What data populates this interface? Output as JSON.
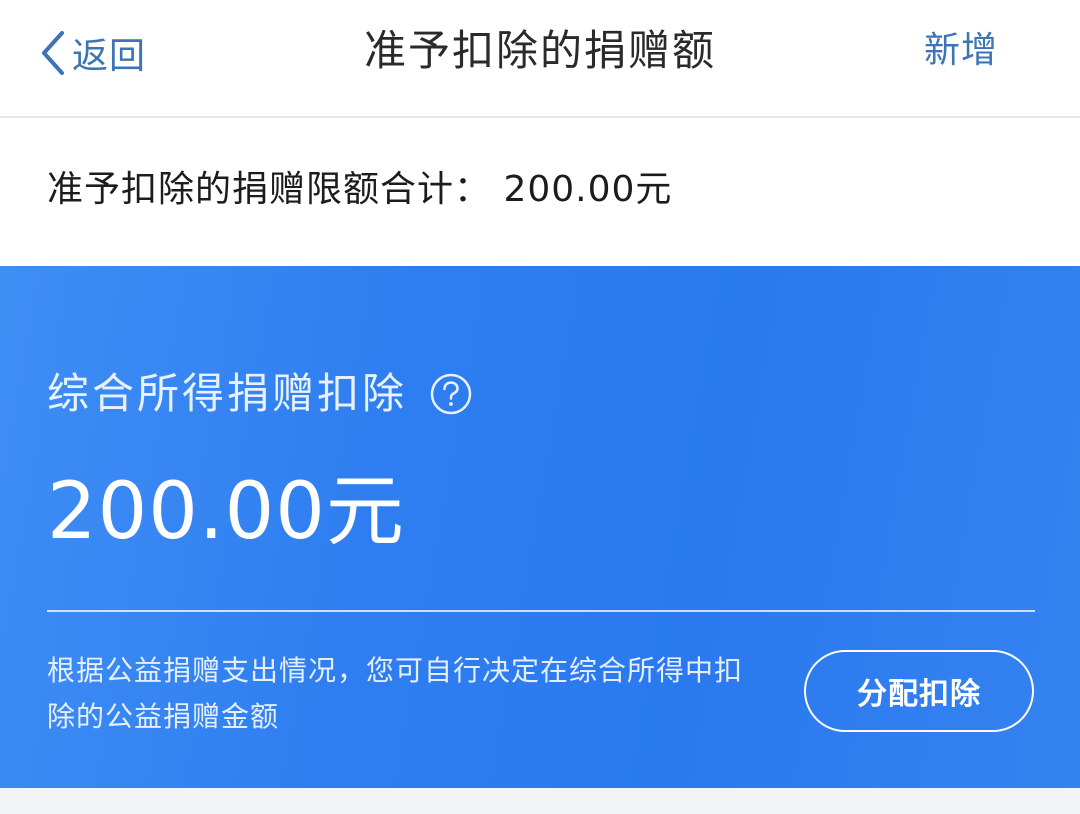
{
  "nav": {
    "back_label": "返回",
    "title": "准予扣除的捐赠额",
    "action_label": "新增"
  },
  "limit": {
    "text": "准予扣除的捐赠限额合计： 200.00元"
  },
  "card": {
    "title": "综合所得捐赠扣除",
    "amount": "200.00元",
    "description": "根据公益捐赠支出情况，您可自行决定在综合所得中扣除的公益捐赠金额",
    "button_label": "分配扣除"
  },
  "icons": {
    "back": "chevron-left-icon",
    "help": "question-circle-icon"
  },
  "colors": {
    "accent_text": "#3d74b3",
    "card_blue": "#2f7ef1"
  }
}
